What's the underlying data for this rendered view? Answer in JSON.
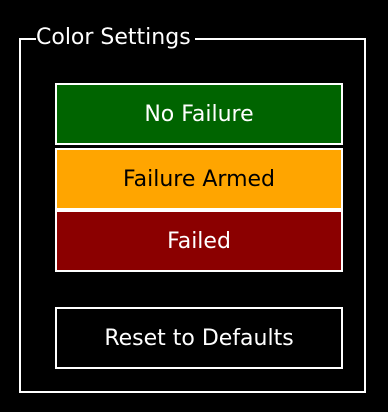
{
  "group": {
    "title": "Color Settings"
  },
  "colors": {
    "no_failure": {
      "label": "No Failure",
      "background": "#006400",
      "text": "#ffffff"
    },
    "failure_armed": {
      "label": "Failure Armed",
      "background": "#ffa500",
      "text": "#000000"
    },
    "failed": {
      "label": "Failed",
      "background": "#8b0000",
      "text": "#ffffff"
    }
  },
  "actions": {
    "reset_label": "Reset to Defaults",
    "reset_background": "#000000",
    "reset_text": "#ffffff"
  }
}
